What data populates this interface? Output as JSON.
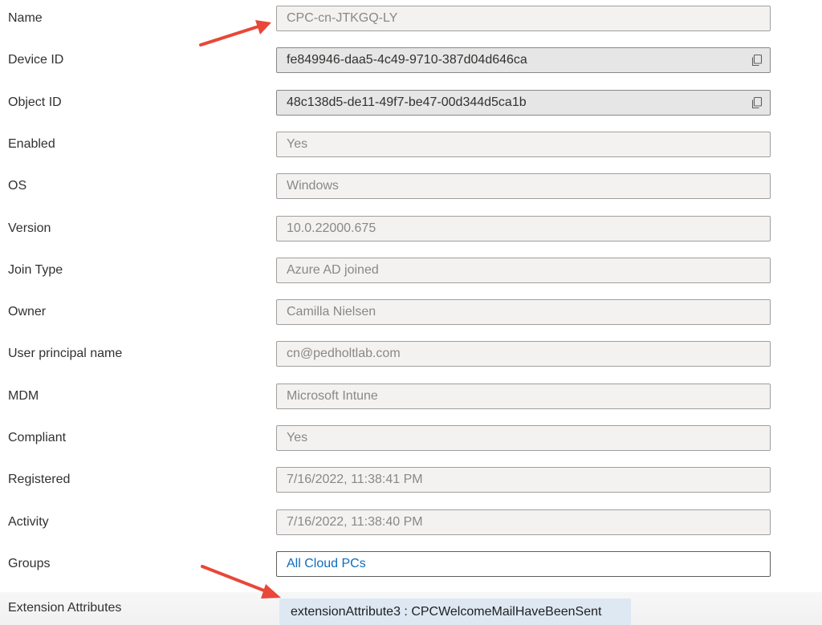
{
  "properties": [
    {
      "label": "Name",
      "value": "CPC-cn-JTKGQ-LY",
      "style": "disabled",
      "copyable": false
    },
    {
      "label": "Device ID",
      "value": "fe849946-daa5-4c49-9710-387d04d646ca",
      "style": "readonly",
      "copyable": true
    },
    {
      "label": "Object ID",
      "value": "48c138d5-de11-49f7-be47-00d344d5ca1b",
      "style": "readonly",
      "copyable": true
    },
    {
      "label": "Enabled",
      "value": "Yes",
      "style": "disabled",
      "copyable": false
    },
    {
      "label": "OS",
      "value": "Windows",
      "style": "disabled",
      "copyable": false
    },
    {
      "label": "Version",
      "value": "10.0.22000.675",
      "style": "disabled",
      "copyable": false
    },
    {
      "label": "Join Type",
      "value": "Azure AD joined",
      "style": "disabled",
      "copyable": false
    },
    {
      "label": "Owner",
      "value": "Camilla Nielsen",
      "style": "disabled",
      "copyable": false
    },
    {
      "label": "User principal name",
      "value": "cn@pedholtlab.com",
      "style": "disabled",
      "copyable": false
    },
    {
      "label": "MDM",
      "value": "Microsoft Intune",
      "style": "disabled",
      "copyable": false
    },
    {
      "label": "Compliant",
      "value": "Yes",
      "style": "disabled",
      "copyable": false
    },
    {
      "label": "Registered",
      "value": "7/16/2022, 11:38:41 PM",
      "style": "disabled",
      "copyable": false
    },
    {
      "label": "Activity",
      "value": "7/16/2022, 11:38:40 PM",
      "style": "disabled",
      "copyable": false
    },
    {
      "label": "Groups",
      "value": "All Cloud PCs",
      "style": "link",
      "copyable": false
    }
  ],
  "extension_attributes": {
    "label": "Extension Attributes",
    "value": "extensionAttribute3 : CPCWelcomeMailHaveBeenSent"
  },
  "icons": {
    "copy": "copy-icon",
    "annotation": "red-arrow"
  },
  "colors": {
    "arrow": "#e8473a",
    "link": "#0f6cbd",
    "chip": "#dde8f3"
  }
}
